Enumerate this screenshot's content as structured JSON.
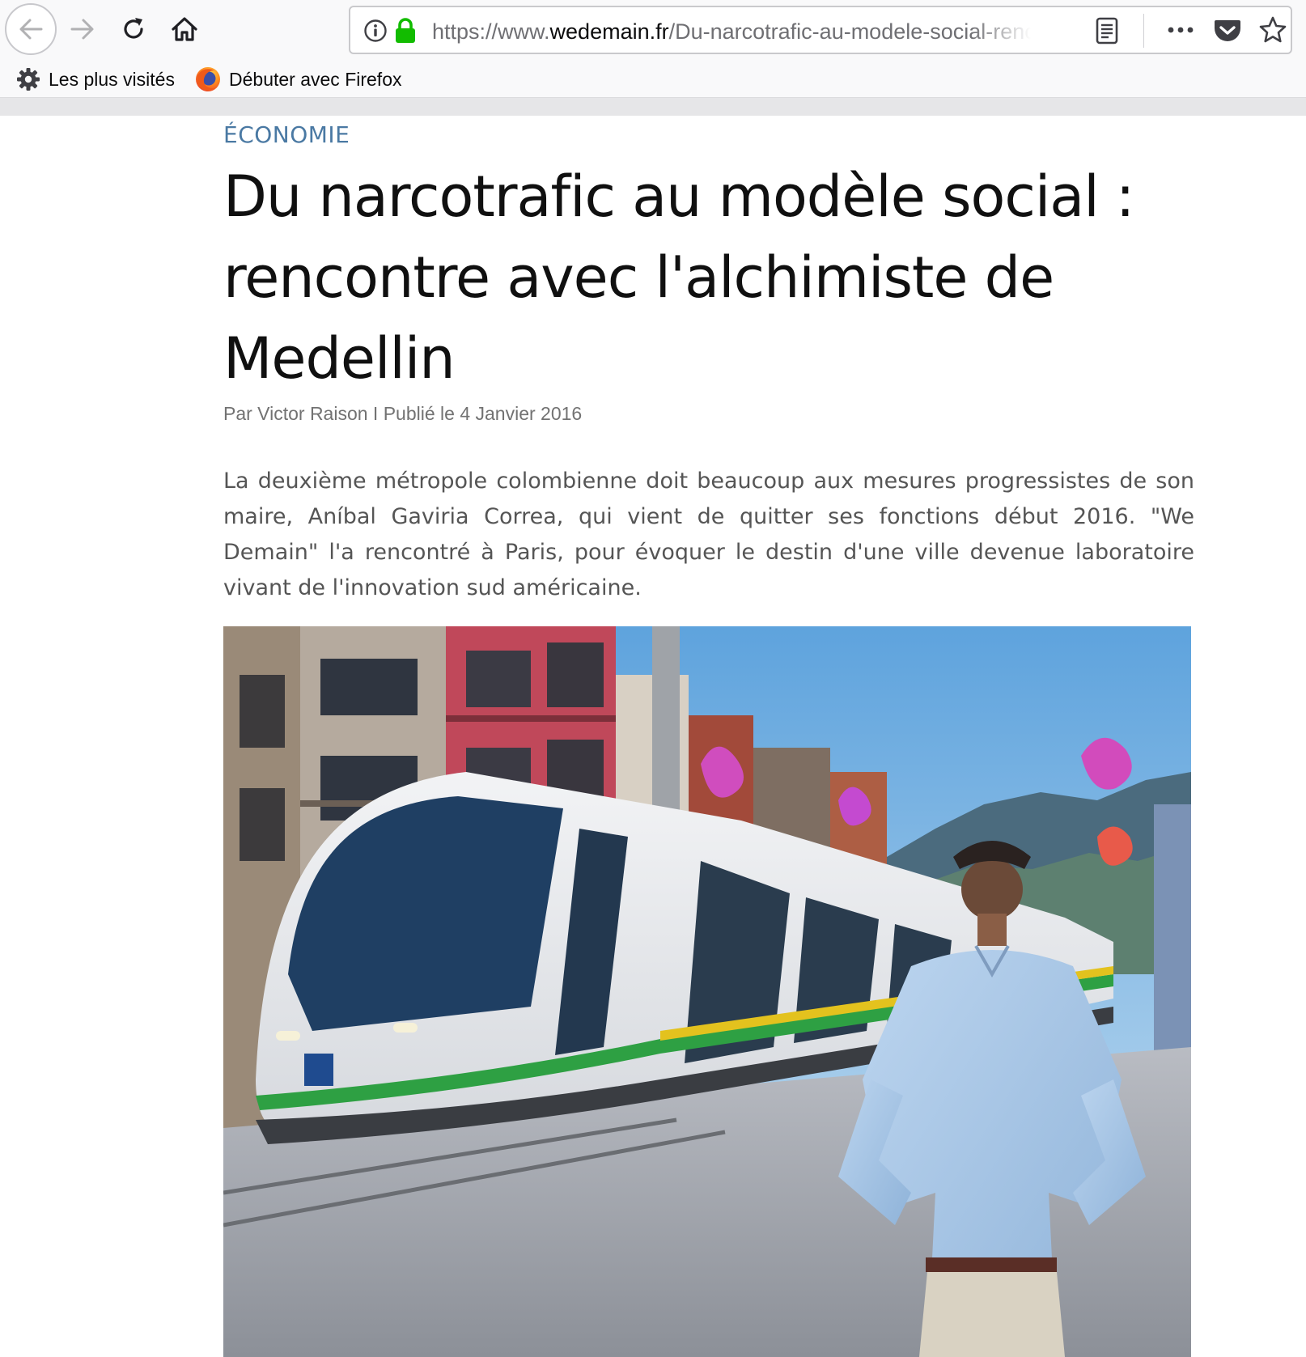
{
  "browser": {
    "url_prefix": "https://www.",
    "url_domain": "wedemain.fr",
    "url_path": "/Du-narcotrafic-au-modele-social-rencontre-avec-l-alchimiste-de-Medellin",
    "bookmarks": [
      {
        "label": "Les plus visités",
        "icon": "gear-icon"
      },
      {
        "label": "Débuter avec Firefox",
        "icon": "firefox-icon"
      }
    ],
    "icons": [
      "back-arrow-icon",
      "forward-arrow-icon",
      "reload-icon",
      "home-icon",
      "info-icon",
      "lock-icon",
      "reader-view-icon",
      "more-dots-icon",
      "pocket-icon",
      "star-icon"
    ],
    "colors": {
      "lock": "#12bc00",
      "pocket": "#ef4056"
    }
  },
  "article": {
    "category": "ÉCONOMIE",
    "title": "Du narcotrafic au modèle social : rencontre avec l'alchimiste de Medellin",
    "byline": "Par Victor Raison I Publié le 4 Janvier 2016",
    "lead": "La deuxième métropole colombienne doit beaucoup aux mesures progressistes de son maire, Aníbal Gaviria Correa, qui vient de quitter ses fonctions début 2016. \"We Demain\" l'a rencontré à Paris, pour évoquer le destin d'une ville devenue laboratoire vivant de l'innovation sud américaine.",
    "colors": {
      "category": "#4a79a3",
      "title": "#101010",
      "byline": "#727272",
      "lead": "#555555"
    }
  }
}
